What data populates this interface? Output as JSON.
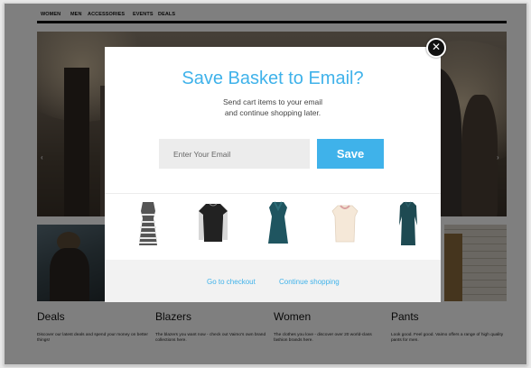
{
  "nav": {
    "items": [
      "WOMEN",
      "MEN",
      "ACCESSORIES",
      "EVENTS",
      "DEALS"
    ]
  },
  "hero": {
    "prev_arrow": "‹",
    "next_arrow": "›"
  },
  "categories": [
    {
      "title": "Deals",
      "desc": "Discover our latest deals and spend your money on better things!"
    },
    {
      "title": "Blazers",
      "desc": "The blazers you want now - check out Vaimo's own brand collections here."
    },
    {
      "title": "Women",
      "desc": "The clothes you love - discover over 20 world-class fashion brands here."
    },
    {
      "title": "Pants",
      "desc": "Look good. Feel good. Vaimo offers a range of high quality pants for men."
    }
  ],
  "modal": {
    "title": "Save Basket to Email?",
    "subtitle_line1": "Send cart items to your email",
    "subtitle_line2": "and continue shopping later.",
    "email_placeholder": "Enter Your Email",
    "email_value": "",
    "save_label": "Save",
    "close_icon": "close-icon",
    "items": [
      {
        "name": "striped-dress",
        "color": "#555555",
        "accent": "#e5e5e5"
      },
      {
        "name": "black-sweater",
        "color": "#222222",
        "accent": "#d8d8d8"
      },
      {
        "name": "teal-dress",
        "color": "#1f5560",
        "accent": "#2c6d78"
      },
      {
        "name": "cream-blouse",
        "color": "#f5e8d8",
        "accent": "#d9a0a0"
      },
      {
        "name": "teal-long-dress",
        "color": "#1e4a52",
        "accent": "#2a5d66"
      }
    ],
    "checkout_label": "Go to checkout",
    "continue_label": "Continue shopping"
  },
  "colors": {
    "accent": "#3fb2ea",
    "overlay": "rgba(0,0,0,0.5)"
  }
}
